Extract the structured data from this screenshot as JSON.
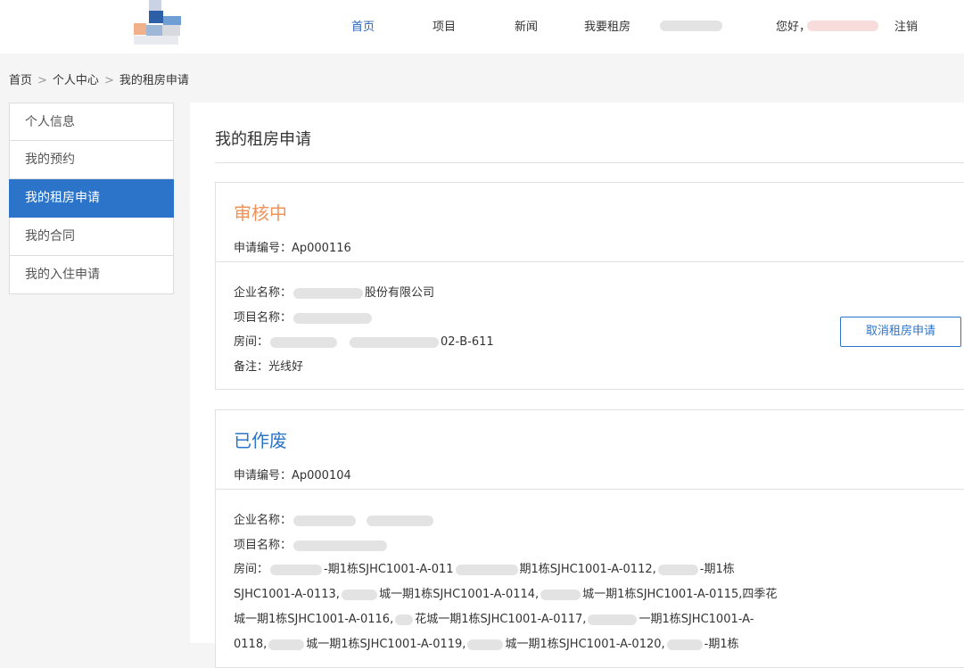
{
  "header": {
    "nav": [
      "首页",
      "项目",
      "新闻",
      "我要租房"
    ],
    "greeting": "您好，",
    "logout": "注销"
  },
  "breadcrumb": [
    "首页",
    "个人中心",
    "我的租房申请"
  ],
  "sidebar": {
    "items": [
      "个人信息",
      "我的预约",
      "我的租房申请",
      "我的合同",
      "我的入住申请"
    ],
    "active_index": 2
  },
  "main": {
    "title": "我的租房申请",
    "cards": [
      {
        "status": "审核中",
        "app_no": "申请编号：Ap000116",
        "company_label": "企业名称：",
        "company_suffix": "股份有限公司",
        "project_label": "项目名称：",
        "room_label": "房间：",
        "room_suffix": "02-B-611",
        "note": "备注：光线好",
        "cancel_label": "取消租房申请"
      },
      {
        "status": "已作废",
        "app_no": "申请编号：Ap000104",
        "company_label": "企业名称：",
        "project_label": "项目名称：",
        "room_label": "房间：",
        "room_lines": [
          [
            "-期1栋SJHC1001-A-011",
            "期1栋SJHC1001-A-0112,",
            "-期1栋"
          ],
          [
            "SJHC1001-A-0113,",
            "城一期1栋SJHC1001-A-0114,",
            "城一期1栋SJHC1001-A-0115,四季花"
          ],
          [
            "城一期1栋SJHC1001-A-0116,",
            "花城一期1栋SJHC1001-A-0117,",
            "一期1栋SJHC1001-A-"
          ],
          [
            "0118,",
            "城一期1栋SJHC1001-A-0119,",
            "城一期1栋SJHC1001-A-0120,",
            "-期1栋"
          ]
        ]
      }
    ]
  },
  "colors": {
    "accent": "#2c74c9",
    "review": "#f0935a"
  }
}
